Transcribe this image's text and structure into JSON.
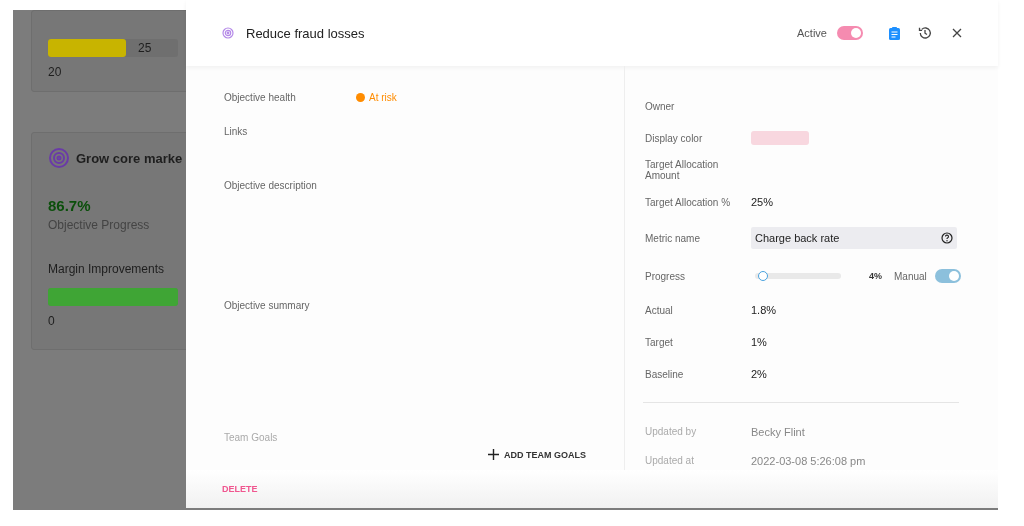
{
  "background": {
    "cards": [
      {
        "kind": "bar",
        "color": "#c8b400",
        "level": 0.6,
        "bar_value": "25",
        "value": "20"
      },
      {
        "kind": "objective",
        "title": "Grow core marke",
        "progress": "86.7%",
        "progress_label": "Objective Progress",
        "metric": "Margin Improvements",
        "color": "#3fa535",
        "level": 1,
        "value": "0"
      }
    ]
  },
  "drawer": {
    "title": "Reduce fraud losses",
    "active_label": "Active",
    "active": true,
    "left_fields": [
      {
        "label": "Objective health",
        "status": "At risk",
        "color": "#ff8c00"
      },
      {
        "label": "Links"
      },
      {
        "label": "Objective description"
      },
      {
        "label": "Objective summary"
      }
    ],
    "team_goals": {
      "label": "Team Goals",
      "button": "ADD TEAM GOALS"
    },
    "right_fields": [
      {
        "kind": "text",
        "label": "Owner"
      },
      {
        "kind": "color",
        "label": "Display color",
        "color": "#f8d7df"
      },
      {
        "kind": "text",
        "label": "Target Allocation Amount"
      },
      {
        "kind": "text",
        "label": "Target Allocation %",
        "value": "25%"
      },
      {
        "kind": "metric",
        "label": "Metric name",
        "value": "Charge back rate"
      },
      {
        "kind": "progress",
        "label": "Progress",
        "level": 0.04,
        "reading": "4%",
        "manual_label": "Manual",
        "manual": true
      },
      {
        "kind": "text",
        "label": "Actual",
        "value": "1.8%"
      },
      {
        "kind": "text",
        "label": "Target",
        "value": "1%"
      },
      {
        "kind": "text",
        "label": "Baseline",
        "value": "2%"
      }
    ],
    "meta": [
      {
        "label": "Updated by",
        "value": "Becky Flint"
      },
      {
        "label": "Updated at",
        "value": "2022-03-08 5:26:08 pm"
      }
    ],
    "delete": "DELETE"
  }
}
